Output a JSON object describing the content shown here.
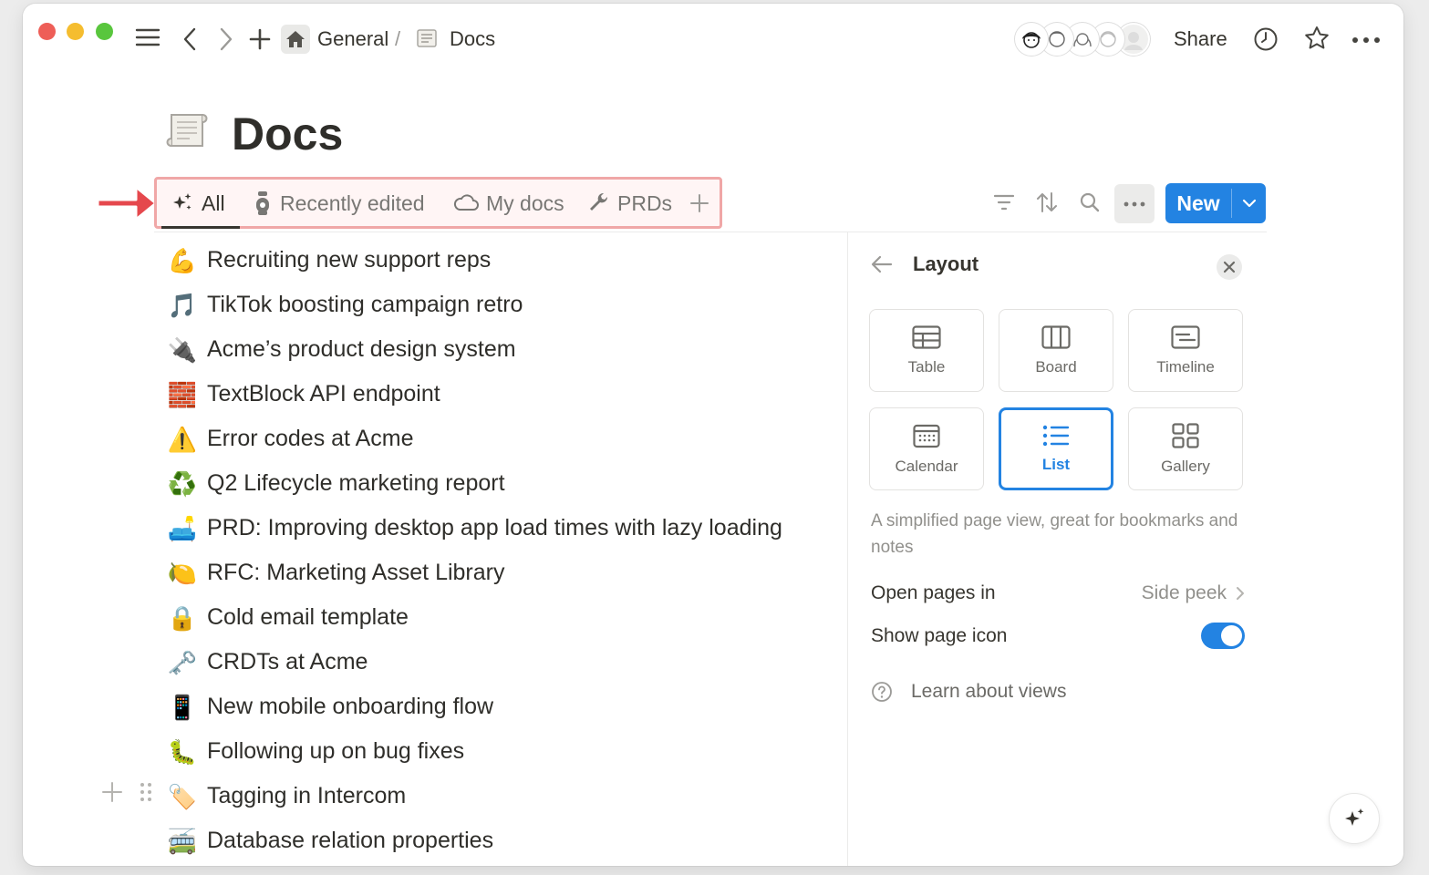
{
  "window": {
    "breadcrumb": {
      "workspace": "General",
      "separator": "/",
      "page": "Docs"
    },
    "share_label": "Share"
  },
  "page": {
    "title": "Docs"
  },
  "tabs": [
    {
      "label": "All",
      "icon": "sparkles-icon",
      "active": true
    },
    {
      "label": "Recently edited",
      "icon": "stopwatch-icon",
      "active": false
    },
    {
      "label": "My docs",
      "icon": "cloud-icon",
      "active": false
    },
    {
      "label": "PRDs",
      "icon": "wrench-icon",
      "active": false
    }
  ],
  "toolbar": {
    "new_label": "New"
  },
  "docs": [
    {
      "icon": "💪",
      "title": "Recruiting new support reps"
    },
    {
      "icon": "🎵",
      "title": "TikTok boosting campaign retro"
    },
    {
      "icon": "🔌",
      "title": "Acme’s product design system"
    },
    {
      "icon": "🧱",
      "title": "TextBlock API endpoint"
    },
    {
      "icon": "⚠️",
      "title": "Error codes at Acme"
    },
    {
      "icon": "♻️",
      "title": "Q2 Lifecycle marketing report"
    },
    {
      "icon": "🛋️",
      "title": "PRD: Improving desktop app load times with lazy loading"
    },
    {
      "icon": "🍋",
      "title": "RFC: Marketing Asset Library"
    },
    {
      "icon": "🔒",
      "title": "Cold email template"
    },
    {
      "icon": "🗝️",
      "title": "CRDTs at Acme"
    },
    {
      "icon": "📱",
      "title": "New mobile onboarding flow"
    },
    {
      "icon": "🐛",
      "title": "Following up on bug fixes"
    },
    {
      "icon": "🏷️",
      "title": "Tagging in Intercom"
    },
    {
      "icon": "🚎",
      "title": "Database relation properties"
    }
  ],
  "layout_panel": {
    "title": "Layout",
    "options": [
      {
        "label": "Table",
        "icon": "table-icon",
        "selected": false
      },
      {
        "label": "Board",
        "icon": "board-icon",
        "selected": false
      },
      {
        "label": "Timeline",
        "icon": "timeline-icon",
        "selected": false
      },
      {
        "label": "Calendar",
        "icon": "calendar-icon",
        "selected": false
      },
      {
        "label": "List",
        "icon": "list-icon",
        "selected": true
      },
      {
        "label": "Gallery",
        "icon": "gallery-icon",
        "selected": false
      }
    ],
    "description": "A simplified page view, great for bookmarks and notes",
    "open_pages_in": {
      "label": "Open pages in",
      "value": "Side peek"
    },
    "show_page_icon": {
      "label": "Show page icon",
      "enabled": true
    },
    "learn_link": "Learn about views"
  },
  "colors": {
    "accent": "#2383e2",
    "highlight_border": "#f0a7a7",
    "arrow": "#e5484d"
  }
}
